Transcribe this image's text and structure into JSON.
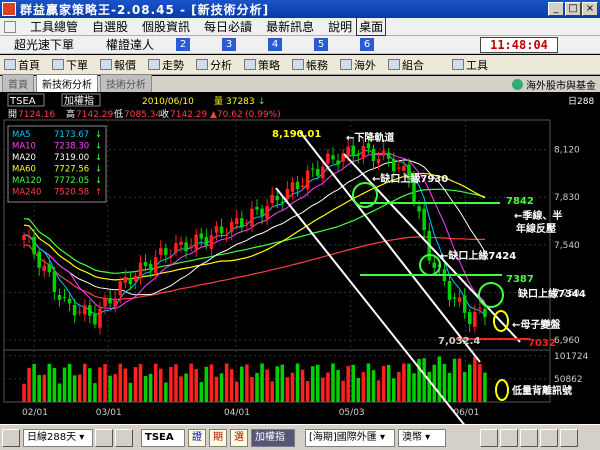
{
  "window": {
    "title": "群益贏家策略王-2.08.45 - [新技術分析]"
  },
  "menu": [
    "工具總管",
    "自選股",
    "個股資訊",
    "每日必讀",
    "最新訊息",
    "說明",
    "桌面"
  ],
  "row2": {
    "item1": "超光速下單",
    "item2": "權證達人",
    "numbers": [
      "2",
      "3",
      "4",
      "5",
      "6"
    ]
  },
  "clock": "11:48:04",
  "toolbar": [
    "首頁",
    "下單",
    "報價",
    "走勢",
    "分析",
    "策略",
    "帳務",
    "海外",
    "組合",
    "工具"
  ],
  "tabs": {
    "items": [
      "首頁",
      "新技術分析",
      "技術分析"
    ],
    "right": "海外股市與基金"
  },
  "header": {
    "symbol": "TSEA",
    "name": "加權指",
    "date": "2010/06/10",
    "vol_label": "量",
    "vol": "37283",
    "vol_arrow": "↓",
    "open_label": "開",
    "open": "7124.16",
    "high_label": "高",
    "high": "7142.29",
    "low_label": "低",
    "low": "7085.34",
    "close_label": "收",
    "close": "7142.29",
    "chg": "▲70.62",
    "pct": "(0.99%)",
    "day": "日288"
  },
  "legend": [
    {
      "name": "MA5",
      "value": "7173.67",
      "arrow": "↓",
      "color": "#00c8ff"
    },
    {
      "name": "MA10",
      "value": "7238.30",
      "arrow": "↓",
      "color": "#ff40ff"
    },
    {
      "name": "MA20",
      "value": "7319.00",
      "arrow": "↓",
      "color": "#ffffff"
    },
    {
      "name": "MA60",
      "value": "7727.56",
      "arrow": "↓",
      "color": "#ffff00"
    },
    {
      "name": "MA120",
      "value": "7772.05",
      "arrow": "↓",
      "color": "#40ff40"
    },
    {
      "name": "MA240",
      "value": "7520.58",
      "arrow": "↑",
      "color": "#ff4040"
    }
  ],
  "chart_data": {
    "type": "candlestick",
    "title": "TSEA 加權指",
    "y_ticks": [
      "8,120",
      "7,830",
      "7,540",
      "7,250",
      "6,960"
    ],
    "vol_ticks": [
      "101724",
      "50862"
    ],
    "x_ticks": [
      "02/01",
      "03/01",
      "04/01",
      "05/03",
      "06/01"
    ],
    "ylim": [
      6900,
      8300
    ],
    "annotations": [
      {
        "text": "8,190.01",
        "color": "#ffff00"
      },
      {
        "text": "7,032.4",
        "color": "#cccccc"
      },
      {
        "text": "←下降軌道",
        "color": "#ffffff"
      },
      {
        "text": "←缺口上緣7930",
        "color": "#ffffff"
      },
      {
        "text": "7842",
        "color": "#40ff40"
      },
      {
        "text": "←季線、半",
        "color": "#ffffff"
      },
      {
        "text": "年線反壓",
        "color": "#ffffff"
      },
      {
        "text": "←缺口上緣7424",
        "color": "#ffffff"
      },
      {
        "text": "7387",
        "color": "#40ff40"
      },
      {
        "text": "缺口上緣7344",
        "color": "#ffffff"
      },
      {
        "text": "←母子變盤",
        "color": "#ffffff"
      },
      {
        "text": "7032",
        "color": "#ff2020"
      },
      {
        "text": "低量背離訊號",
        "color": "#ffffff"
      }
    ]
  },
  "statusbar": {
    "period": "日線288天",
    "symbol": "TSEA",
    "btn1": "證",
    "btn2": "期",
    "btn3": "選",
    "name": "加權指",
    "exchange": "[海期]國際外匯",
    "currency": "澳幣"
  }
}
